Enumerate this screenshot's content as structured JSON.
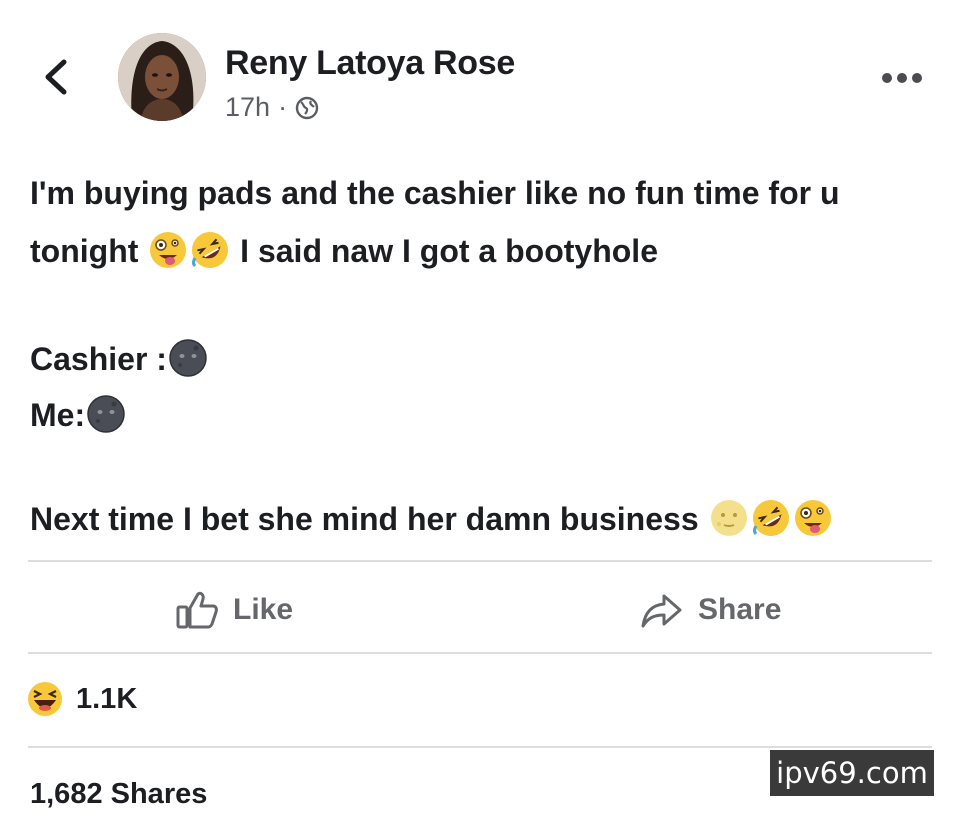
{
  "post": {
    "author_name": "Reny Latoya Rose",
    "time": "17h",
    "separator": "·",
    "privacy_icon": "globe-icon",
    "lines": {
      "line1": "I'm buying pads and the cashier like no fun time for u",
      "line2_a": "tonight ",
      "line2_b": " I said naw I got a bootyhole",
      "line3": "Cashier :",
      "line4": "Me:",
      "line5": "Next time I bet she mind her damn business "
    }
  },
  "actions": {
    "like_label": "Like",
    "share_label": "Share"
  },
  "stats": {
    "reaction_count": "1.1K",
    "shares_text": "1,682 Shares"
  },
  "watermark": {
    "text": "ipv69.com"
  },
  "icons": [
    "back-arrow-icon",
    "more-options-icon",
    "globe-icon",
    "like-thumb-icon",
    "share-arrow-icon",
    "laughing-reaction-icon"
  ],
  "colors": {
    "text": "#1c1e21",
    "secondary": "#65676b",
    "divider": "#dadde1"
  }
}
